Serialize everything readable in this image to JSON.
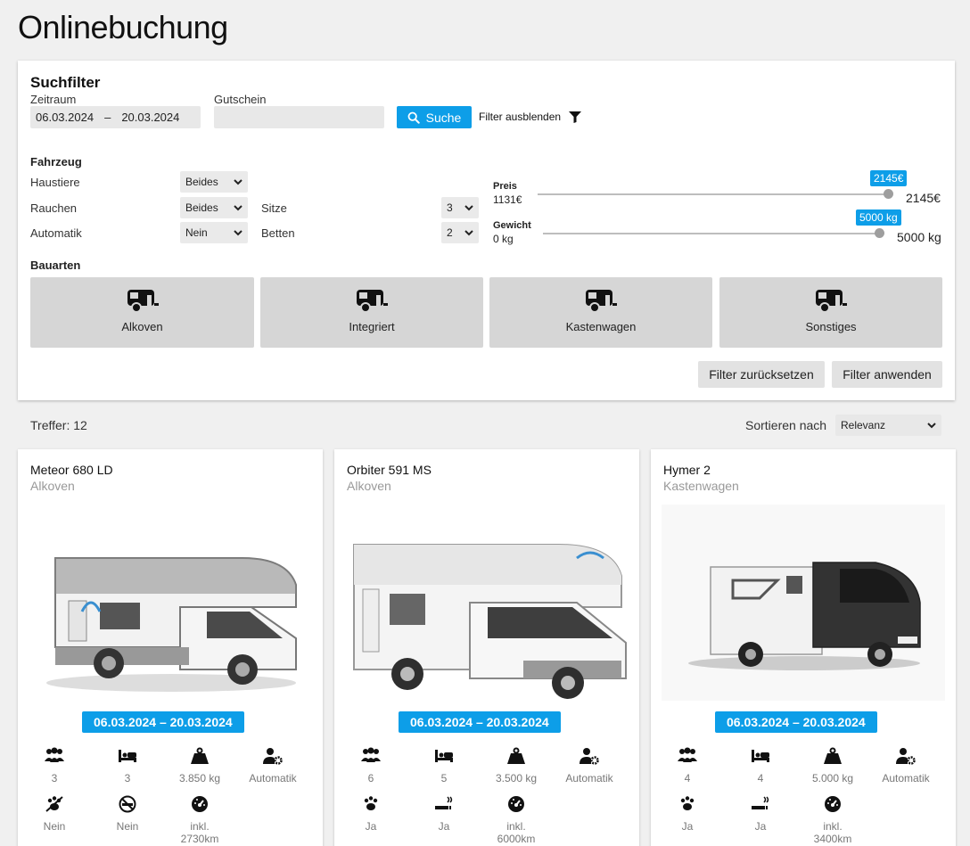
{
  "page": {
    "title": "Onlinebuchung"
  },
  "filter": {
    "heading": "Suchfilter",
    "period_label": "Zeitraum",
    "date_from": "06.03.2024",
    "date_sep": "–",
    "date_to": "20.03.2024",
    "voucher_label": "Gutschein",
    "voucher_value": "",
    "search_label": "Suche",
    "hide_filter_label": "Filter ausblenden",
    "vehicle_heading": "Fahrzeug",
    "pets_label": "Haustiere",
    "pets_value": "Beides",
    "smoking_label": "Rauchen",
    "smoking_value": "Beides",
    "automatic_label": "Automatik",
    "automatic_value": "Nein",
    "seats_label": "Sitze",
    "seats_value": "3",
    "beds_label": "Betten",
    "beds_value": "2",
    "price": {
      "label": "Preis",
      "min": "1131€",
      "max": "2145€",
      "badge": "2145€",
      "fraction": 1.0
    },
    "weight": {
      "label": "Gewicht",
      "min": "0 kg",
      "max": "5000 kg",
      "badge": "5000 kg",
      "fraction": 1.0
    },
    "types_heading": "Bauarten",
    "types": [
      {
        "label": "Alkoven",
        "icon": "camper-icon"
      },
      {
        "label": "Integriert",
        "icon": "camper-icon"
      },
      {
        "label": "Kastenwagen",
        "icon": "camper-icon"
      },
      {
        "label": "Sonstiges",
        "icon": "camper-icon"
      }
    ],
    "reset_label": "Filter zurücksetzen",
    "apply_label": "Filter anwenden"
  },
  "results": {
    "hits_label": "Treffer: 12",
    "sort_label": "Sortieren nach",
    "sort_value": "Relevanz"
  },
  "accent": "#0d9ee8",
  "cards": [
    {
      "title": "Meteor 680 LD",
      "type": "Alkoven",
      "dates": "06.03.2024  –  20.03.2024",
      "persons": "3",
      "beds": "3",
      "weight": "3.850 kg",
      "gear": "Automatik",
      "pets": "Nein",
      "smoking": "Nein",
      "km": "inkl. 2730km"
    },
    {
      "title": "Orbiter 591 MS",
      "type": "Alkoven",
      "dates": "06.03.2024  –  20.03.2024",
      "persons": "6",
      "beds": "5",
      "weight": "3.500 kg",
      "gear": "Automatik",
      "pets": "Ja",
      "smoking": "Ja",
      "km": "inkl. 6000km"
    },
    {
      "title": "Hymer 2",
      "type": "Kastenwagen",
      "dates": "06.03.2024  –  20.03.2024",
      "persons": "4",
      "beds": "4",
      "weight": "5.000 kg",
      "gear": "Automatik",
      "pets": "Ja",
      "smoking": "Ja",
      "km": "inkl. 3400km"
    }
  ]
}
